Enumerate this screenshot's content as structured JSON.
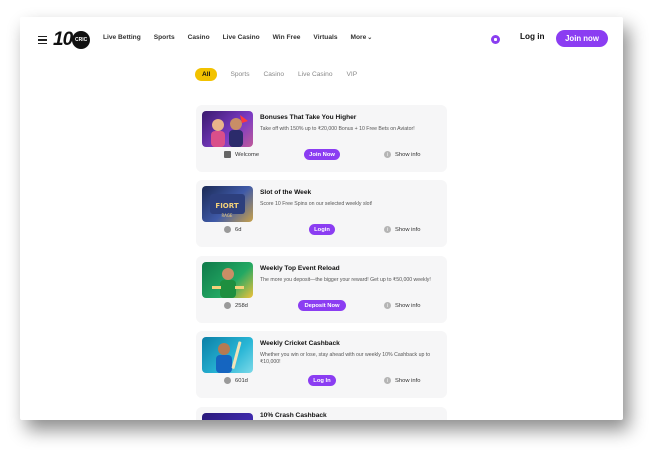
{
  "header": {
    "logo_text": "10",
    "logo_sub": "CRIC",
    "nav": [
      "Live Betting",
      "Sports",
      "Casino",
      "Live Casino",
      "Win Free",
      "Virtuals",
      "More"
    ],
    "login_label": "Log in",
    "join_label": "Join now"
  },
  "filters": [
    "All",
    "Sports",
    "Casino",
    "Live Casino",
    "VIP"
  ],
  "promos": [
    {
      "title": "Bonuses That Take You Higher",
      "description": "Take off with 150% up to ₹20,000 Bonus + 10 Free Bets on Aviator!",
      "meta": "Welcome",
      "cta": "Join Now",
      "info": "Show info"
    },
    {
      "title": "Slot of the Week",
      "description": "Score 10 Free Spins on our selected weekly slot!",
      "meta": "6d",
      "cta": "Login",
      "info": "Show info"
    },
    {
      "title": "Weekly Top Event Reload",
      "description": "The more you deposit—the bigger your reward! Get up to ₹50,000 weekly!",
      "meta": "258d",
      "cta": "Deposit Now",
      "info": "Show info"
    },
    {
      "title": "Weekly Cricket Cashback",
      "description": "Whether you win or lose, stay ahead with our weekly 10% Cashback up to ₹10,000!",
      "meta": "601d",
      "cta": "Log In",
      "info": "Show info"
    },
    {
      "title": "10% Crash Cashback"
    }
  ],
  "colors": {
    "accent": "#8b3df2",
    "active_tab": "#f2c200",
    "card_bg": "#f6f6f7"
  }
}
